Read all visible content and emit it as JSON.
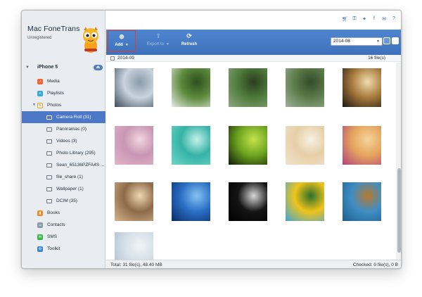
{
  "app": {
    "name": "Mac FoneTrans",
    "status": "Unregistered"
  },
  "device": {
    "name": "iPhone 5"
  },
  "sidebar": {
    "items": [
      {
        "label": "Media",
        "icon": "music-icon",
        "color": "#f0643a"
      },
      {
        "label": "Playlists",
        "icon": "playlist-icon",
        "color": "#34a8d8"
      }
    ],
    "photos": {
      "label": "Photos",
      "icon": "flower-icon"
    },
    "albums": [
      {
        "label": "Camera Roll (31)",
        "selected": true
      },
      {
        "label": "Panoramas (0)"
      },
      {
        "label": "Videos (3)"
      },
      {
        "label": "Photo Library (295)"
      },
      {
        "label": "Sean_65136PZFA4S ..."
      },
      {
        "label": "file_share (1)"
      },
      {
        "label": "Wallpaper (1)"
      },
      {
        "label": "DCIM (35)"
      }
    ],
    "more": [
      {
        "label": "Books",
        "icon": "book-icon",
        "color": "#f28c28"
      },
      {
        "label": "Contacts",
        "icon": "contacts-icon",
        "color": "#8e9aa6"
      },
      {
        "label": "SMS",
        "icon": "message-icon",
        "color": "#39b54a"
      },
      {
        "label": "Toolkit",
        "icon": "toolbox-icon",
        "color": "#3a86d6"
      }
    ]
  },
  "toolbar": {
    "add_label": "Add",
    "export_label": "Export to",
    "refresh_label": "Refresh",
    "date_value": "2014-08"
  },
  "group": {
    "label": "2014-09",
    "count": "16 file(s)"
  },
  "photos": [
    {
      "name": "photo-screen",
      "colors": [
        "#3c4a5a",
        "#c9d4df",
        "#8a9aa8"
      ]
    },
    {
      "name": "photo-plant",
      "colors": [
        "#e6ebe4",
        "#5d8a3c",
        "#2f4f1e"
      ]
    },
    {
      "name": "photo-leaves-light",
      "colors": [
        "#8ea780",
        "#4e7a3a",
        "#2b3d20"
      ]
    },
    {
      "name": "photo-leaves-dark",
      "colors": [
        "#9fb19a",
        "#5b7b48",
        "#334a2a"
      ]
    },
    {
      "name": "photo-hand-sun",
      "colors": [
        "#1d1710",
        "#a77a3c",
        "#f2dcae"
      ]
    },
    {
      "name": "photo-pink-bokeh",
      "colors": [
        "#e4b6c8",
        "#c895b3",
        "#f3d6e0"
      ]
    },
    {
      "name": "photo-teal-sprout",
      "colors": [
        "#6fd6c9",
        "#34b3a6",
        "#c7f1ea"
      ]
    },
    {
      "name": "photo-green-leaves",
      "colors": [
        "#0e1a06",
        "#6ea520",
        "#c5e34c"
      ]
    },
    {
      "name": "photo-room-bright",
      "colors": [
        "#f0e3cc",
        "#e6cfa7",
        "#f8f1e4"
      ]
    },
    {
      "name": "photo-swing",
      "colors": [
        "#b0427c",
        "#e6a45e",
        "#f3d59a"
      ]
    },
    {
      "name": "photo-beach",
      "colors": [
        "#d9b48a",
        "#8c6a4a",
        "#f1d7b2"
      ]
    },
    {
      "name": "photo-moon",
      "colors": [
        "#0b2a66",
        "#2a6fc5",
        "#86c3f0"
      ]
    },
    {
      "name": "photo-dark-hand",
      "colors": [
        "#000000",
        "#141414",
        "#d8d8d8"
      ]
    },
    {
      "name": "photo-sunflower",
      "colors": [
        "#3fa6d8",
        "#f0c419",
        "#2b6f2b"
      ]
    },
    {
      "name": "photo-blue-drops",
      "colors": [
        "#1e5e8f",
        "#3f8ec4",
        "#b8782e"
      ]
    },
    {
      "name": "photo-sky-snow",
      "colors": [
        "#a7bccb",
        "#d3dfe7",
        "#f1f4f6"
      ]
    }
  ],
  "status": {
    "total": "Total: 31 file(s), 48.40 MB",
    "checked": "Checked: 0 file(s), 0 B"
  },
  "colors": {
    "accent": "#4d78c8",
    "toolbar": "#3e70bb",
    "highlight_border": "#e53935"
  }
}
